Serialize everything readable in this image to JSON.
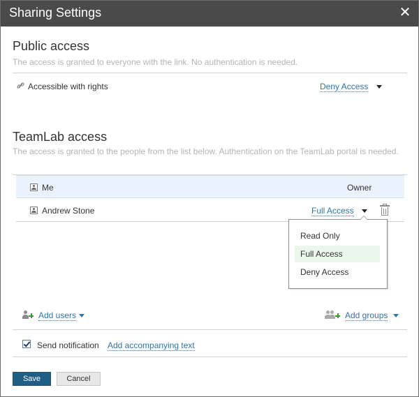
{
  "dialog": {
    "title": "Sharing Settings",
    "close_glyph": "✕"
  },
  "public_access": {
    "heading": "Public access",
    "description": "The access is granted to everyone with the link. No authentication is needed.",
    "row_label": "Accessible with rights",
    "rights_value": "Deny Access"
  },
  "teamlab_access": {
    "heading": "TeamLab access",
    "description": "The access is granted to the people from the list below. Authentication on the TeamLab portal is needed.",
    "users": [
      {
        "name": "Me",
        "rights": "Owner"
      },
      {
        "name": "Andrew Stone",
        "rights": "Full Access"
      }
    ]
  },
  "rights_menu": {
    "options": [
      "Read Only",
      "Full Access",
      "Deny Access"
    ],
    "selected": "Full Access"
  },
  "add": {
    "users_label": "Add users",
    "groups_label": "Add groups"
  },
  "notification": {
    "label": "Send notification",
    "checked": true,
    "link": "Add accompanying text"
  },
  "buttons": {
    "save": "Save",
    "cancel": "Cancel"
  },
  "colors": {
    "titlebar": "#4a4a4a",
    "link": "#2f75a6",
    "primary_button": "#1f5f86",
    "selected_row": "#eaf2fb",
    "menu_highlight": "#eaf7ea"
  },
  "icons": {
    "link": "chain-link-icon",
    "user": "user-icon",
    "delete": "trash-icon",
    "add_user": "add-user-icon",
    "add_group": "add-group-icon"
  }
}
